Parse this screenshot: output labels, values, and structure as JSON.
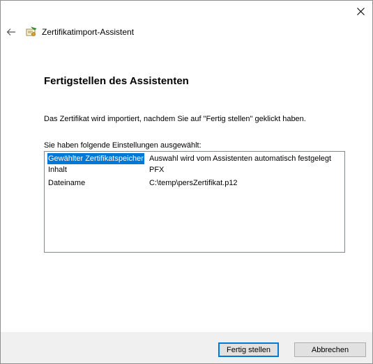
{
  "window": {
    "title": "Zertifikatimport-Assistent",
    "close_icon": "close-icon",
    "back_icon": "back-arrow-icon",
    "app_icon": "certificate-icon"
  },
  "page": {
    "heading": "Fertigstellen des Assistenten",
    "info": "Das Zertifikat wird importiert, nachdem Sie auf \"Fertig stellen\" geklickt haben.",
    "settings_label": "Sie haben folgende Einstellungen ausgewählt:"
  },
  "settings": [
    {
      "key": "Gewählter Zertifikatspeicher",
      "value": "Auswahl wird vom Assistenten automatisch festgelegt",
      "selected": true
    },
    {
      "key": "Inhalt",
      "value": "PFX",
      "selected": false
    },
    {
      "key": "Dateiname",
      "value": "C:\\temp\\persZertifikat.p12",
      "selected": false
    }
  ],
  "buttons": {
    "finish": "Fertig stellen",
    "cancel": "Abbrechen"
  },
  "colors": {
    "selection": "#0078d7",
    "footer": "#f0f0f0",
    "button_face": "#e1e1e1"
  }
}
